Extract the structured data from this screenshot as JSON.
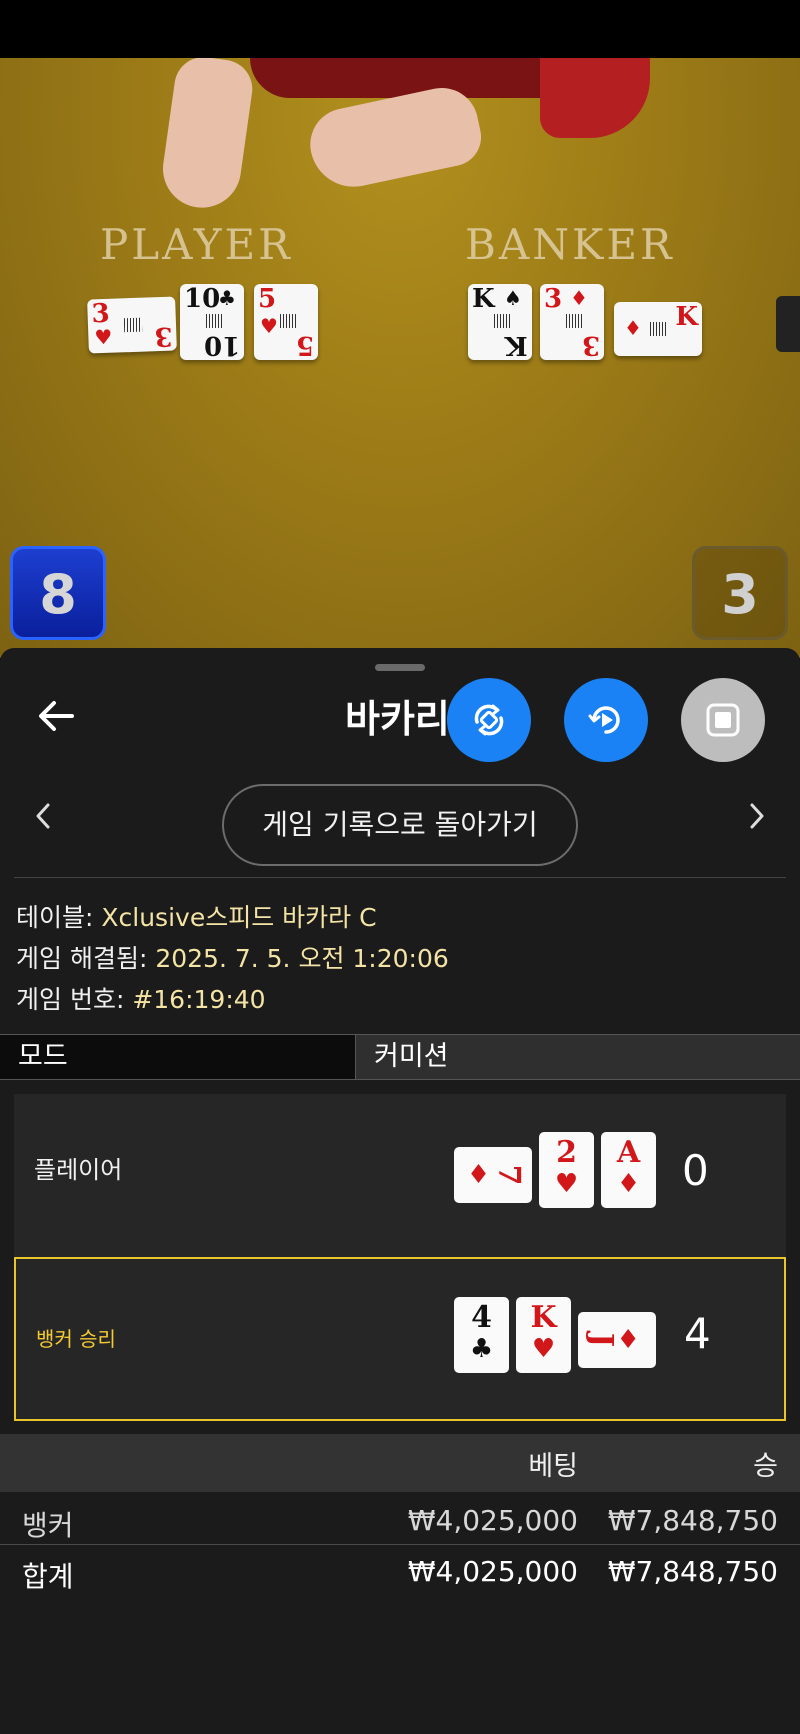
{
  "video": {
    "labels": {
      "player": "PLAYER",
      "banker": "BANKER"
    },
    "player_cards": [
      {
        "rank": "3",
        "suit": "♥",
        "color": "red",
        "orientation": "sideways"
      },
      {
        "rank": "10",
        "suit": "♣",
        "color": "black",
        "orientation": "upright"
      },
      {
        "rank": "5",
        "suit": "♥",
        "color": "red",
        "orientation": "upright"
      }
    ],
    "banker_cards": [
      {
        "rank": "K",
        "suit": "♠",
        "color": "black",
        "orientation": "upright"
      },
      {
        "rank": "3",
        "suit": "♦",
        "color": "red",
        "orientation": "upright"
      },
      {
        "rank": "K",
        "suit": "♦",
        "color": "red",
        "orientation": "sideways"
      }
    ],
    "scores": {
      "player": "8",
      "banker": "3"
    }
  },
  "sheet": {
    "title": "바카리",
    "back_icon": "arrow-left-icon",
    "fab_icons": [
      "rotate-sync-icon",
      "replay-play-icon",
      "stop-icon"
    ],
    "history_button": "게임 기록으로 돌아가기",
    "info": {
      "table_label": "테이블:",
      "table_value": "Xclusive스피드 바카라 C",
      "resolved_label": "게임 해결됨:",
      "resolved_value": "2025. 7. 5. 오전 1:20:06",
      "number_label": "게임 번호:",
      "number_value": "#16:19:40"
    },
    "mode": {
      "left": "모드",
      "right": "커미션"
    },
    "results": {
      "player": {
        "label": "플레이어",
        "total": "0",
        "cards": [
          {
            "rank": "7",
            "suit": "♦",
            "color": "red",
            "orientation": "sideways"
          },
          {
            "rank": "2",
            "suit": "♥",
            "color": "red",
            "orientation": "upright"
          },
          {
            "rank": "A",
            "suit": "♦",
            "color": "red",
            "orientation": "upright"
          }
        ]
      },
      "banker": {
        "label": "뱅커 승리",
        "total": "4",
        "winner": true,
        "cards": [
          {
            "rank": "4",
            "suit": "♣",
            "color": "black",
            "orientation": "upright"
          },
          {
            "rank": "K",
            "suit": "♥",
            "color": "red",
            "orientation": "upright"
          },
          {
            "rank": "J",
            "suit": "♦",
            "color": "red",
            "orientation": "sideways"
          }
        ]
      }
    },
    "bets": {
      "headers": {
        "bet": "베팅",
        "win": "승"
      },
      "rows": [
        {
          "name": "뱅커",
          "bet": "₩4,025,000",
          "win": "₩7,848,750"
        },
        {
          "name": "합계",
          "bet": "₩4,025,000",
          "win": "₩7,848,750"
        }
      ]
    }
  },
  "colors": {
    "felt": "#9c7b17",
    "accent_blue": "#1a82f5",
    "winner_gold": "#e8c52a",
    "value_text": "#f3e3a4",
    "sheet_bg": "#1b1b1b"
  }
}
